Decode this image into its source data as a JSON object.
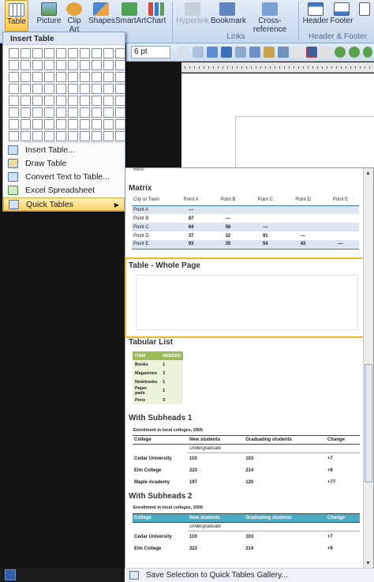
{
  "ribbon": {
    "buttons": {
      "table": "Table",
      "picture": "Picture",
      "clipart": "Clip Art",
      "shapes": "Shapes",
      "smartart": "SmartArt",
      "chart": "Chart",
      "hyperlink": "Hyperlink",
      "bookmark": "Bookmark",
      "crossref": "Cross-reference",
      "header": "Header",
      "footer": "Footer"
    },
    "groups": {
      "links": "Links",
      "headerfooter": "Header & Footer"
    },
    "font_size": "6 pt"
  },
  "insert_menu": {
    "title": "Insert Table",
    "items": {
      "insert_table": "Insert Table...",
      "draw_table": "Draw Table",
      "convert": "Convert Text to Table...",
      "excel": "Excel Spreadsheet",
      "quick_tables": "Quick Tables"
    }
  },
  "gallery": {
    "top_cut": "Beds",
    "matrix": {
      "title": "Matrix",
      "header": [
        "City or Town",
        "Point A",
        "Point B",
        "Point C",
        "Point D",
        "Point E"
      ],
      "rows": [
        [
          "Point A",
          "—",
          "",
          "",
          "",
          ""
        ],
        [
          "Point B",
          "87",
          "—",
          "",
          "",
          ""
        ],
        [
          "Point C",
          "64",
          "56",
          "—",
          "",
          ""
        ],
        [
          "Point D",
          "37",
          "32",
          "91",
          "—",
          ""
        ],
        [
          "Point E",
          "93",
          "35",
          "54",
          "43",
          "—"
        ]
      ]
    },
    "whole_page": {
      "title": "Table - Whole Page"
    },
    "tabular_list": {
      "title": "Tabular List",
      "header": [
        "ITEM",
        "NEEDED"
      ],
      "rows": [
        [
          "Books",
          "1"
        ],
        [
          "Magazines",
          "3"
        ],
        [
          "Notebooks",
          "1"
        ],
        [
          "Paper pads",
          "1"
        ],
        [
          "Pens",
          "3"
        ]
      ]
    },
    "subheads1": {
      "title": "With Subheads 1",
      "caption": "Enrollment in local colleges, 2005",
      "header": [
        "College",
        "New students",
        "Graduating students",
        "Change"
      ],
      "subhead": "Undergraduate",
      "rows": [
        [
          "Cedar University",
          "110",
          "103",
          "+7"
        ],
        [
          "Elm College",
          "223",
          "214",
          "+9"
        ],
        [
          "Maple Academy",
          "197",
          "120",
          "+77"
        ]
      ]
    },
    "subheads2": {
      "title": "With Subheads 2",
      "caption": "Enrollment in local colleges, 2005",
      "header": [
        "College",
        "New students",
        "Graduating students",
        "Change"
      ],
      "subhead": "Undergraduate",
      "rows": [
        [
          "Cedar University",
          "110",
          "103",
          "+7"
        ],
        [
          "Elm College",
          "223",
          "214",
          "+9"
        ]
      ]
    },
    "footer": "Save Selection to Quick Tables Gallery..."
  },
  "colors": {
    "highlight": "#f0b823",
    "accent_blue": "#4bacc6",
    "list_green": "#9bbb59"
  }
}
